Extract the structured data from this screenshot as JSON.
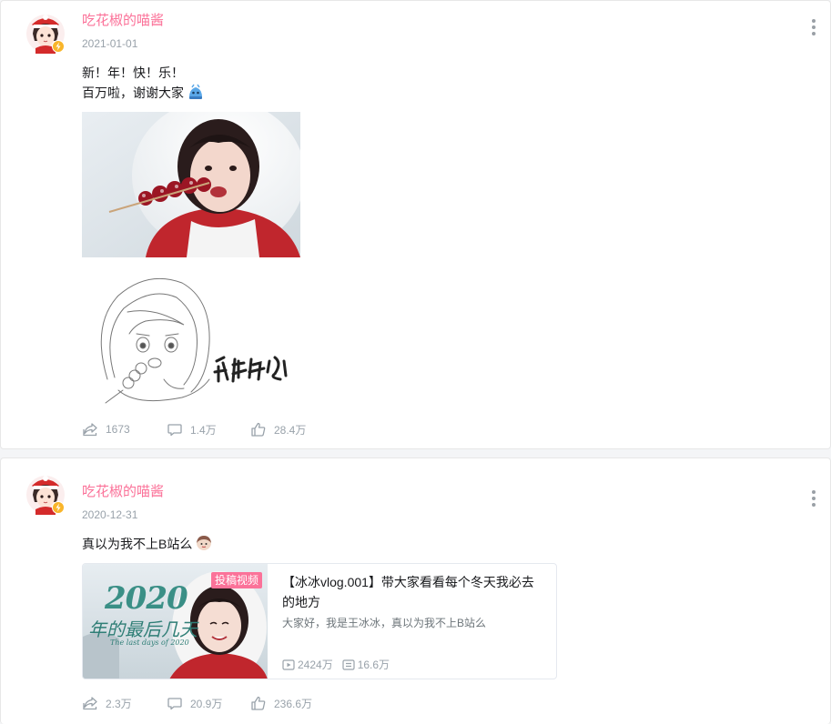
{
  "theme": {
    "accent": "#fb7299",
    "muted": "#99a2aa",
    "badge_color": "#fb7299"
  },
  "posts": [
    {
      "author": "吃花椒的喵酱",
      "date": "2021-01-01",
      "text_lines": [
        "新！年！快！乐！",
        "百万啦，谢谢大家"
      ],
      "images": [
        {
          "type": "photo",
          "description_icon": "photo-girl-candied-haws"
        },
        {
          "type": "sketch",
          "caption_art": "新年快乐"
        }
      ],
      "stats": {
        "share": "1673",
        "comment": "1.4万",
        "like": "28.4万"
      }
    },
    {
      "author": "吃花椒的喵酱",
      "date": "2020-12-31",
      "text": "真以为我不上B站么",
      "video": {
        "badge": "投稿视频",
        "thumb_text": "2020",
        "thumb_subtitle": "年的最后几天",
        "thumb_caption": "The last days of 2020",
        "title": "【冰冰vlog.001】带大家看看每个冬天我必去的地方",
        "desc": "大家好，我是王冰冰，真以为我不上B站么",
        "plays": "2424万",
        "danmaku": "16.6万"
      },
      "stats": {
        "share": "2.3万",
        "comment": "20.9万",
        "like": "236.6万"
      }
    }
  ]
}
